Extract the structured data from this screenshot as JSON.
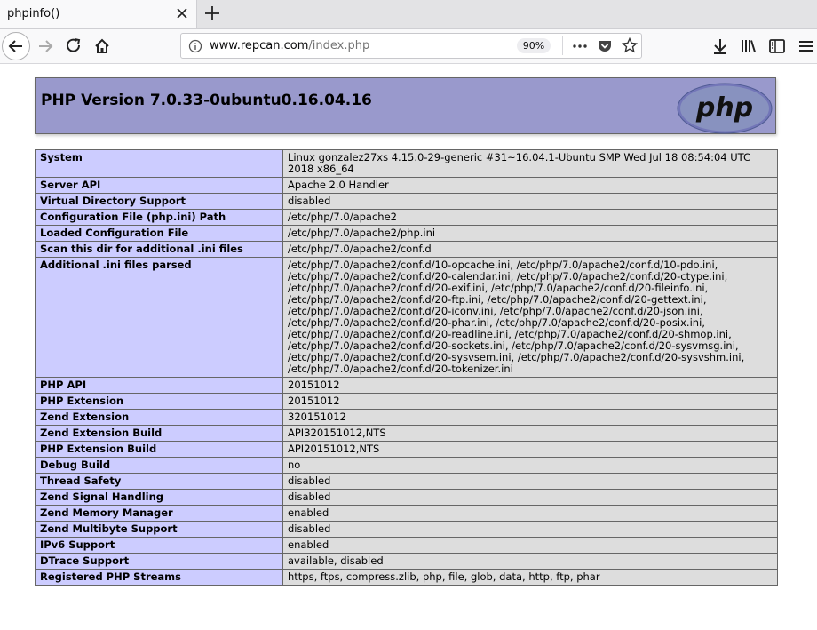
{
  "browser": {
    "tab_title": "phpinfo()",
    "url_host": "www.repcan.com",
    "url_path": "/index.php",
    "zoom": "90%"
  },
  "page": {
    "title": "PHP Version 7.0.33-0ubuntu0.16.04.16",
    "logo_text": "php",
    "rows": [
      {
        "key": "System",
        "value": "Linux gonzalez27xs 4.15.0-29-generic #31~16.04.1-Ubuntu SMP Wed Jul 18 08:54:04 UTC 2018 x86_64"
      },
      {
        "key": "Server API",
        "value": "Apache 2.0 Handler"
      },
      {
        "key": "Virtual Directory Support",
        "value": "disabled"
      },
      {
        "key": "Configuration File (php.ini) Path",
        "value": "/etc/php/7.0/apache2"
      },
      {
        "key": "Loaded Configuration File",
        "value": "/etc/php/7.0/apache2/php.ini"
      },
      {
        "key": "Scan this dir for additional .ini files",
        "value": "/etc/php/7.0/apache2/conf.d"
      },
      {
        "key": "Additional .ini files parsed",
        "value": "/etc/php/7.0/apache2/conf.d/10-opcache.ini, /etc/php/7.0/apache2/conf.d/10-pdo.ini, /etc/php/7.0/apache2/conf.d/20-calendar.ini, /etc/php/7.0/apache2/conf.d/20-ctype.ini, /etc/php/7.0/apache2/conf.d/20-exif.ini, /etc/php/7.0/apache2/conf.d/20-fileinfo.ini, /etc/php/7.0/apache2/conf.d/20-ftp.ini, /etc/php/7.0/apache2/conf.d/20-gettext.ini, /etc/php/7.0/apache2/conf.d/20-iconv.ini, /etc/php/7.0/apache2/conf.d/20-json.ini, /etc/php/7.0/apache2/conf.d/20-phar.ini, /etc/php/7.0/apache2/conf.d/20-posix.ini, /etc/php/7.0/apache2/conf.d/20-readline.ini, /etc/php/7.0/apache2/conf.d/20-shmop.ini, /etc/php/7.0/apache2/conf.d/20-sockets.ini, /etc/php/7.0/apache2/conf.d/20-sysvmsg.ini, /etc/php/7.0/apache2/conf.d/20-sysvsem.ini, /etc/php/7.0/apache2/conf.d/20-sysvshm.ini, /etc/php/7.0/apache2/conf.d/20-tokenizer.ini"
      },
      {
        "key": "PHP API",
        "value": "20151012"
      },
      {
        "key": "PHP Extension",
        "value": "20151012"
      },
      {
        "key": "Zend Extension",
        "value": "320151012"
      },
      {
        "key": "Zend Extension Build",
        "value": "API320151012,NTS"
      },
      {
        "key": "PHP Extension Build",
        "value": "API20151012,NTS"
      },
      {
        "key": "Debug Build",
        "value": "no"
      },
      {
        "key": "Thread Safety",
        "value": "disabled"
      },
      {
        "key": "Zend Signal Handling",
        "value": "disabled"
      },
      {
        "key": "Zend Memory Manager",
        "value": "enabled"
      },
      {
        "key": "Zend Multibyte Support",
        "value": "disabled"
      },
      {
        "key": "IPv6 Support",
        "value": "enabled"
      },
      {
        "key": "DTrace Support",
        "value": "available, disabled"
      },
      {
        "key": "Registered PHP Streams",
        "value": "https, ftps, compress.zlib, php, file, glob, data, http, ftp, phar"
      }
    ]
  },
  "icons": {
    "back": "back-arrow-icon",
    "forward": "forward-arrow-icon",
    "reload": "reload-icon",
    "home": "home-icon",
    "info": "info-icon",
    "more": "more-dots-icon",
    "pocket": "pocket-icon",
    "bookmark": "star-icon",
    "download": "download-icon",
    "library": "library-icon",
    "sidebar": "sidebar-icon",
    "menu": "hamburger-menu-icon"
  },
  "colors": {
    "header_bg": "#9999cc",
    "key_bg": "#ccccff",
    "value_bg": "#dddddd"
  }
}
